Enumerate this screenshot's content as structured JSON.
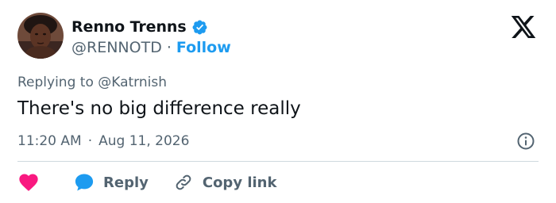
{
  "author": {
    "name": "Renno Trenns",
    "handle": "@RENNOTD",
    "verified": true,
    "avatar_icon": "avatar-photo"
  },
  "follow_label": "Follow",
  "separator": "·",
  "reply_context": {
    "prefix": "Replying to",
    "mention": "@Katrnish"
  },
  "tweet": {
    "text": "There's no big difference really",
    "time": "11:20 AM",
    "date": "Aug 11, 2026"
  },
  "actions": {
    "like_icon": "heart-icon",
    "reply_label": "Reply",
    "copy_link_label": "Copy link"
  },
  "colors": {
    "accent": "#1d9bf0",
    "like": "#f91880",
    "secondary_text": "#536471",
    "primary_text": "#0f1419"
  }
}
